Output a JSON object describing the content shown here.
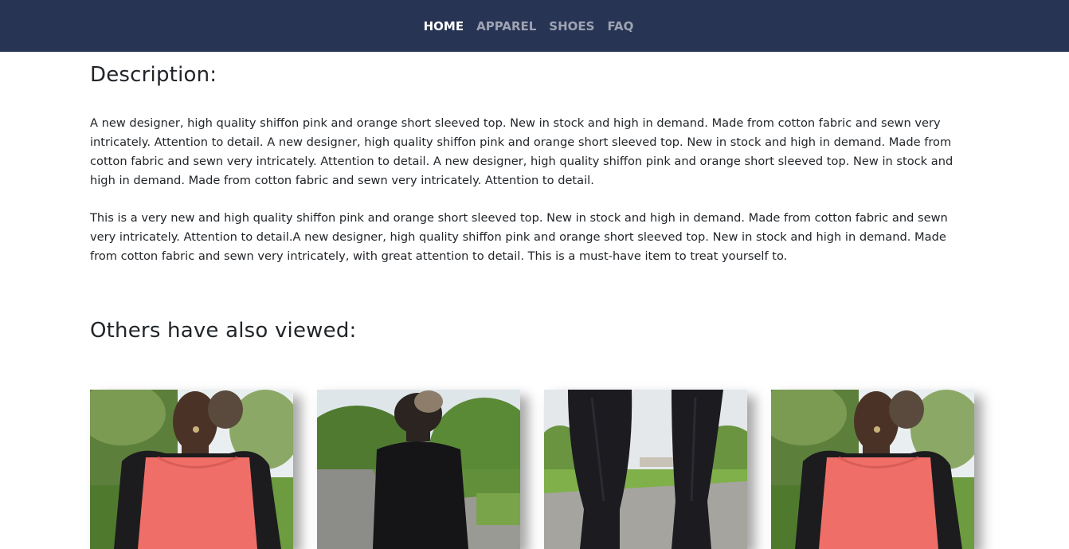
{
  "nav": {
    "items": [
      {
        "label": "HOME",
        "active": true
      },
      {
        "label": "APPAREL",
        "active": false
      },
      {
        "label": "SHOES",
        "active": false
      },
      {
        "label": "FAQ",
        "active": false
      }
    ]
  },
  "description": {
    "heading": "Description:",
    "paragraphs": [
      "A new designer, high quality shiffon pink and orange short sleeved top. New in stock and high in demand. Made from cotton fabric and sewn very intricately. Attention to detail. A new designer, high quality shiffon pink and orange short sleeved top. New in stock and high in demand. Made from cotton fabric and sewn very intricately. Attention to detail. A new designer, high quality shiffon pink and orange short sleeved top. New in stock and high in demand. Made from cotton fabric and sewn very intricately. Attention to detail.",
      "This is a very new and high quality shiffon pink and orange short sleeved top. New in stock and high in demand. Made from cotton fabric and sewn very intricately. Attention to detail.A new designer, high quality shiffon pink and orange short sleeved top. New in stock and high in demand. Made from cotton fabric and sewn very intricately, with great attention to detail. This is a must-have item to treat yourself to."
    ]
  },
  "related": {
    "heading": "Others have also viewed:",
    "items": [
      {
        "image": "woman-pink-top-front-photo"
      },
      {
        "image": "woman-black-top-back-photo"
      },
      {
        "image": "black-leggings-legs-photo"
      },
      {
        "image": "woman-pink-top-front-photo"
      }
    ]
  },
  "colors": {
    "navbar": "#283454",
    "nav_active": "#ffffff",
    "nav_inactive": "#a9aebb",
    "text": "#212529"
  }
}
